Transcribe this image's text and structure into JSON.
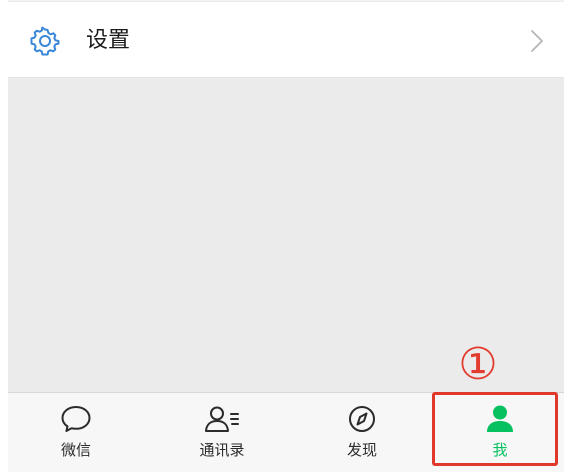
{
  "settings": {
    "label": "设置",
    "icon": "gear-icon",
    "accent": "#3a86d8"
  },
  "annotation": {
    "number": "①",
    "color": "#e33b2e"
  },
  "tabbar": {
    "tabs": [
      {
        "label": "微信",
        "icon": "chat-bubble-icon",
        "active": false
      },
      {
        "label": "通讯录",
        "icon": "contacts-icon",
        "active": false
      },
      {
        "label": "发现",
        "icon": "compass-icon",
        "active": false
      },
      {
        "label": "我",
        "icon": "person-icon",
        "active": true
      }
    ],
    "active_color": "#07c160",
    "inactive_color": "#2b2b2b"
  }
}
